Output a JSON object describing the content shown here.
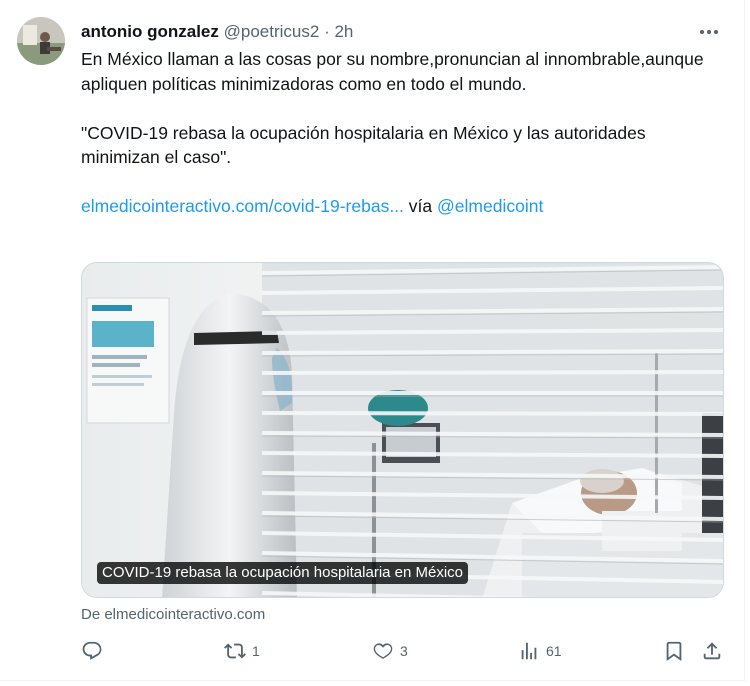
{
  "author": {
    "name": "antonio gonzalez",
    "handle": "@poetricus2",
    "separator": "·",
    "time": "2h"
  },
  "tweet": {
    "paragraph1": "En México llaman a las cosas por su nombre,pronuncian al innombrable,aunque apliquen políticas minimizadoras como en todo el mundo.",
    "paragraph2": "\"COVID-19 rebasa la ocupación hospitalaria en México y las autoridades minimizan el caso\".",
    "link_url": "elmedicointeractivo.com/covid-19-rebas...",
    "via_text": "vía",
    "via_handle": "@elmedicoint"
  },
  "card": {
    "caption": "COVID-19 rebasa la ocupación hospitalaria en México",
    "source": "De elmedicointeractivo.com"
  },
  "actions": {
    "reply_icon": "reply-icon",
    "retweet_icon": "retweet-icon",
    "retweets": "1",
    "like_icon": "heart-icon",
    "likes": "3",
    "views_icon": "views-icon",
    "views": "61",
    "bookmark_icon": "bookmark-icon",
    "share_icon": "share-icon"
  },
  "colors": {
    "link": "#1d9bf0",
    "secondary_text": "#536471",
    "primary_text": "#0f1419"
  }
}
